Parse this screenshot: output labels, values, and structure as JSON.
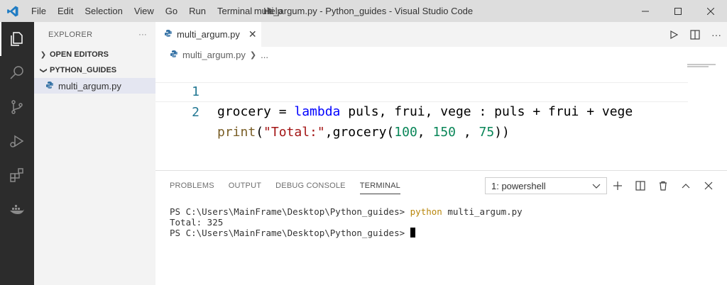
{
  "titlebar": {
    "menu": [
      "File",
      "Edit",
      "Selection",
      "View",
      "Go",
      "Run",
      "Terminal",
      "Help"
    ],
    "window_title": "multi_argum.py - Python_guides - Visual Studio Code"
  },
  "sidebar": {
    "header": "EXPLORER",
    "more": "···",
    "sections": [
      {
        "label": "OPEN EDITORS",
        "expanded": false
      },
      {
        "label": "PYTHON_GUIDES",
        "expanded": true
      }
    ],
    "file": "multi_argum.py"
  },
  "editor": {
    "tab_label": "multi_argum.py",
    "breadcrumb_file": "multi_argum.py",
    "breadcrumb_more": "...",
    "lines": [
      {
        "number": "1"
      },
      {
        "number": "2"
      }
    ]
  },
  "panel": {
    "tabs": [
      "PROBLEMS",
      "OUTPUT",
      "DEBUG CONSOLE",
      "TERMINAL"
    ],
    "active_tab": "TERMINAL",
    "terminal_select": "1: powershell",
    "terminal": {
      "prompt1": "PS C:\\Users\\MainFrame\\Desktop\\Python_guides> ",
      "cmd_python": "python",
      "cmd_args": " multi_argum.py",
      "output": "Total: 325",
      "prompt2": "PS C:\\Users\\MainFrame\\Desktop\\Python_guides> "
    }
  },
  "colors": {
    "activity_bar": "#2c2c2c",
    "sidebar": "#f3f3f3",
    "titlebar": "#dddddd",
    "keyword": "#0000ff",
    "string": "#a31515",
    "number": "#098658",
    "function": "#795e26"
  }
}
